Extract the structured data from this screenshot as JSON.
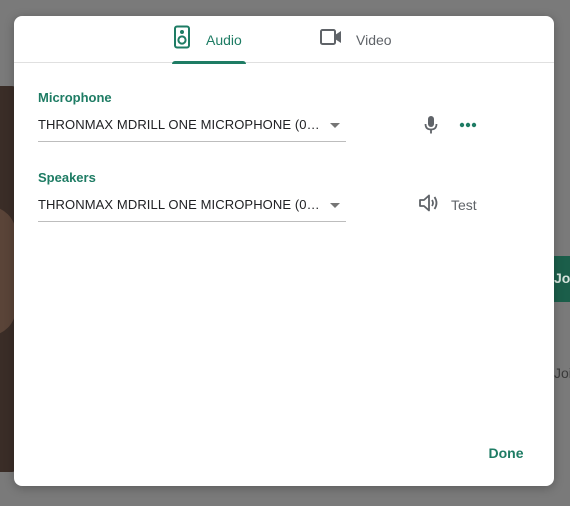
{
  "background": {
    "join_button_label": "Join",
    "other_text": "Join"
  },
  "tabs": [
    {
      "label": "Audio",
      "icon": "speaker-icon",
      "active": true
    },
    {
      "label": "Video",
      "icon": "videocam-icon",
      "active": false
    }
  ],
  "microphone": {
    "label": "Microphone",
    "selected": "THRONMAX MDRILL ONE MICROPHONE (0…"
  },
  "speakers": {
    "label": "Speakers",
    "selected": "THRONMAX MDRILL ONE MICROPHONE (0…",
    "test_label": "Test"
  },
  "footer": {
    "done_label": "Done"
  },
  "colors": {
    "accent": "#1e7c64",
    "icon_gray": "#5f6368"
  }
}
